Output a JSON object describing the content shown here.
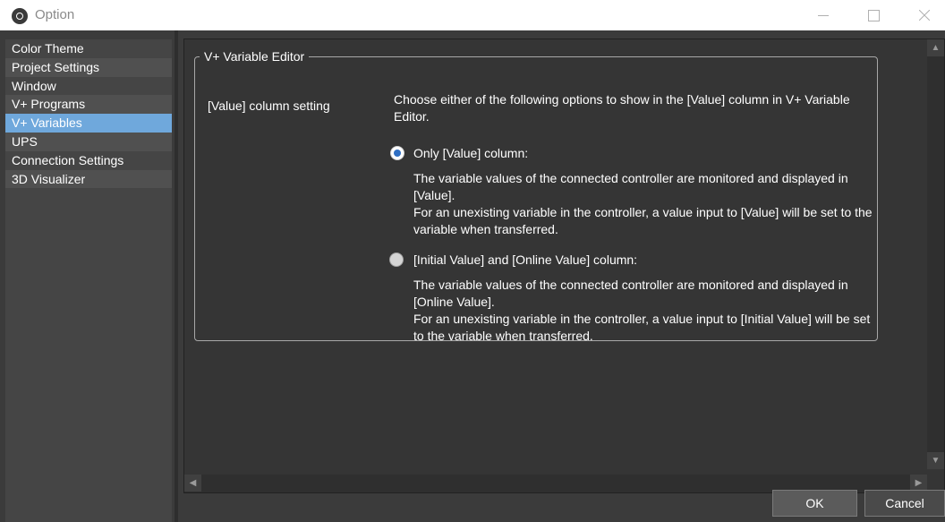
{
  "window": {
    "title": "Option"
  },
  "sidebar": {
    "items": [
      {
        "label": "Color Theme"
      },
      {
        "label": "Project Settings"
      },
      {
        "label": "Window"
      },
      {
        "label": "V+ Programs"
      },
      {
        "label": "V+ Variables"
      },
      {
        "label": "UPS"
      },
      {
        "label": "Connection Settings"
      },
      {
        "label": "3D Visualizer"
      }
    ],
    "selected": "V+ Variables"
  },
  "editor_group": {
    "title": "V+ Variable Editor",
    "setting_label": "[Value] column setting",
    "description": "Choose either of the following options to show in the [Value] column in V+ Variable Editor.",
    "options": [
      {
        "label": "Only [Value] column:",
        "checked": true,
        "line1": "The variable values of the connected controller are monitored and displayed in [Value].",
        "line2": "For an unexisting variable in the controller, a value input to [Value] will be set to the variable when transferred."
      },
      {
        "label": "[Initial Value] and [Online Value] column:",
        "checked": false,
        "line1": "The variable values of the connected controller are monitored and displayed in [Online Value].",
        "line2": "For an unexisting variable in the controller, a value input to [Initial Value] will be set to the variable when transferred."
      }
    ]
  },
  "buttons": {
    "ok": "OK",
    "cancel": "Cancel"
  },
  "icons": {
    "app": "app-logo-icon",
    "minimize": "minimize-icon",
    "maximize": "maximize-icon",
    "close": "close-icon"
  },
  "colors": {
    "selection": "#6fa8dc",
    "radio_checked": "#2f6fc4",
    "background": "#3b3b3b"
  }
}
